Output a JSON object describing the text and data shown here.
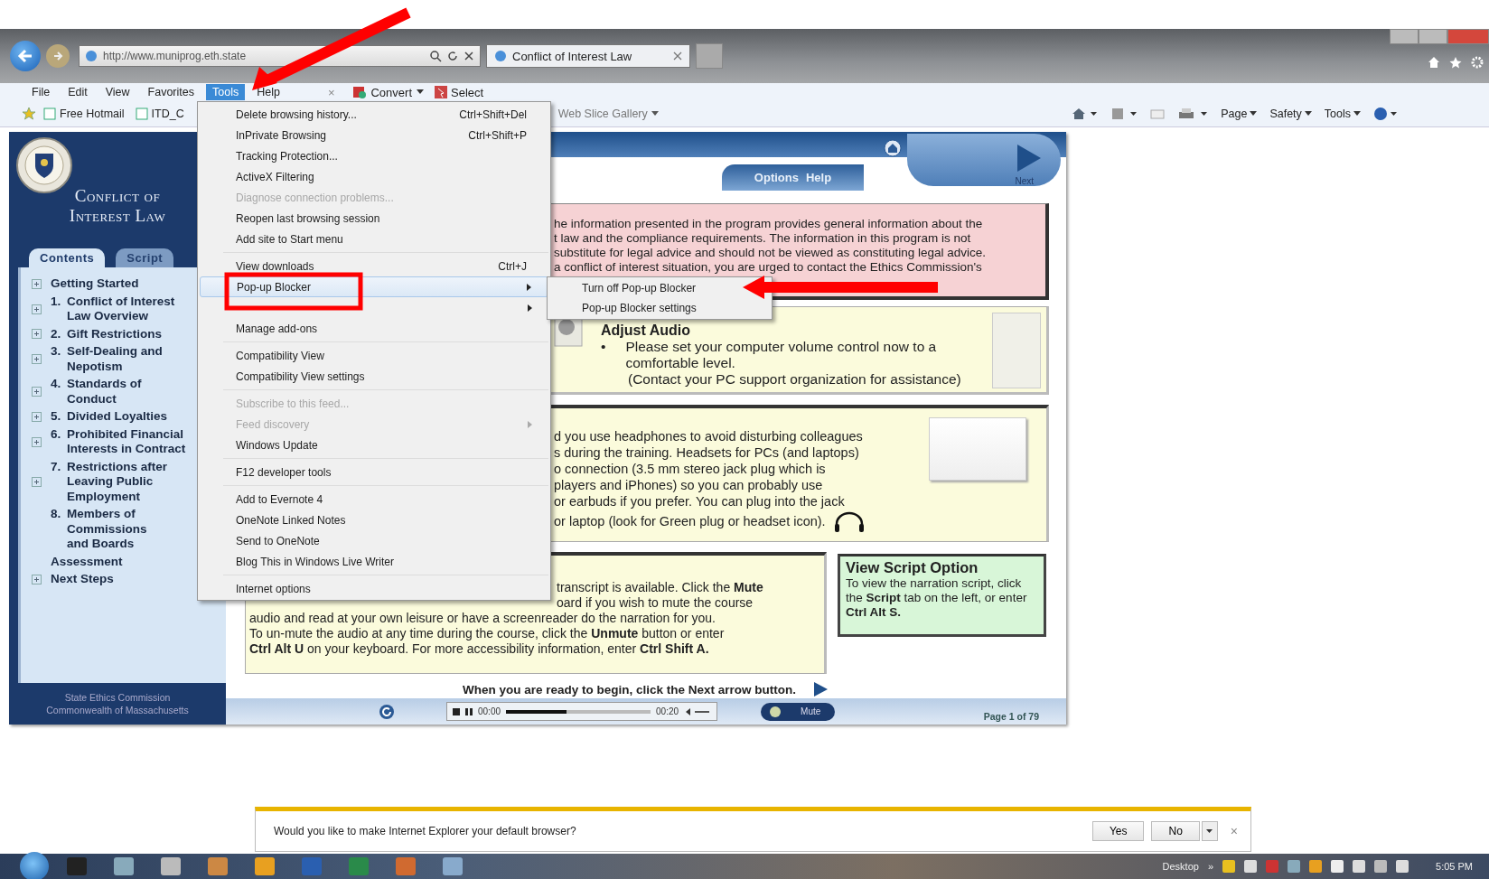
{
  "browser": {
    "address": "http://www.muniprog.eth.state",
    "tab_title": "Conflict of Interest Law",
    "menu_bar": [
      {
        "label": "File",
        "selected": false
      },
      {
        "label": "Edit",
        "selected": false
      },
      {
        "label": "View",
        "selected": false
      },
      {
        "label": "Favorites",
        "selected": false
      },
      {
        "label": "Tools",
        "selected": true
      },
      {
        "label": "Help",
        "selected": false
      }
    ],
    "close_glyph": "×",
    "convert": "Convert",
    "select": "Select",
    "favorites": [
      "Free Hotmail",
      "ITD_C"
    ],
    "web_slice": "Web Slice Gallery",
    "commands": [
      "Page",
      "Safety",
      "Tools"
    ]
  },
  "tools_menu": {
    "groups": [
      [
        {
          "label": "Delete browsing history...",
          "shortcut": "Ctrl+Shift+Del",
          "disabled": false,
          "submenu": false,
          "selected": false
        },
        {
          "label": "InPrivate Browsing",
          "shortcut": "Ctrl+Shift+P",
          "disabled": false,
          "submenu": false,
          "selected": false
        },
        {
          "label": "Tracking Protection...",
          "disabled": false,
          "submenu": false,
          "selected": false
        },
        {
          "label": "ActiveX Filtering",
          "disabled": false,
          "submenu": false,
          "selected": false
        },
        {
          "label": "Diagnose connection problems...",
          "disabled": true,
          "submenu": false,
          "selected": false
        },
        {
          "label": "Reopen last browsing session",
          "disabled": false,
          "submenu": false,
          "selected": false
        },
        {
          "label": "Add site to Start menu",
          "disabled": false,
          "submenu": false,
          "selected": false
        }
      ],
      [
        {
          "label": "View downloads",
          "shortcut": "Ctrl+J",
          "disabled": false,
          "submenu": false,
          "selected": false
        },
        {
          "label": "Pop-up Blocker",
          "disabled": false,
          "submenu": true,
          "selected": true
        },
        {
          "disabled": false,
          "submenu": true,
          "selected": false
        },
        {
          "label": "Manage add-ons",
          "disabled": false,
          "submenu": false,
          "selected": false
        }
      ],
      [
        {
          "label": "Compatibility View",
          "disabled": false,
          "submenu": false,
          "selected": false
        },
        {
          "label": "Compatibility View settings",
          "disabled": false,
          "submenu": false,
          "selected": false
        }
      ],
      [
        {
          "label": "Subscribe to this feed...",
          "disabled": true,
          "submenu": false,
          "selected": false
        },
        {
          "label": "Feed discovery",
          "disabled": true,
          "submenu": true,
          "selected": false
        },
        {
          "label": "Windows Update",
          "disabled": false,
          "submenu": false,
          "selected": false
        }
      ],
      [
        {
          "label": "F12 developer tools",
          "disabled": false,
          "submenu": false,
          "selected": false
        }
      ],
      [
        {
          "label": "Add to Evernote 4",
          "disabled": false,
          "submenu": false,
          "selected": false
        },
        {
          "label": "OneNote Linked Notes",
          "disabled": false,
          "submenu": false,
          "selected": false
        },
        {
          "label": "Send to OneNote",
          "disabled": false,
          "submenu": false,
          "selected": false
        },
        {
          "label": "Blog This in Windows Live Writer",
          "disabled": false,
          "submenu": false,
          "selected": false
        }
      ],
      [
        {
          "label": "Internet options",
          "disabled": false,
          "submenu": false,
          "selected": false
        }
      ]
    ]
  },
  "popup_submenu": [
    "Turn off Pop-up Blocker",
    "Pop-up Blocker settings"
  ],
  "course": {
    "sidebar": {
      "title": "Conflict of Interest Law",
      "tabs": [
        {
          "label": "Contents",
          "selected": true
        },
        {
          "label": "Script",
          "selected": false
        }
      ],
      "tree": [
        {
          "lines": [
            "Getting Started"
          ],
          "expandable": true
        },
        {
          "number": "1.",
          "lines": [
            "Conflict of Interest",
            "Law Overview"
          ],
          "expandable": true
        },
        {
          "number": "2.",
          "lines": [
            "Gift Restrictions"
          ],
          "expandable": true
        },
        {
          "number": "3.",
          "lines": [
            "Self-Dealing and",
            "Nepotism"
          ],
          "expandable": true
        },
        {
          "number": "4.",
          "lines": [
            "Standards of",
            "Conduct"
          ],
          "expandable": true
        },
        {
          "number": "5.",
          "lines": [
            "Divided Loyalties"
          ],
          "expandable": true
        },
        {
          "number": "6.",
          "lines": [
            "Prohibited Financial",
            "Interests in Contract"
          ],
          "expandable": true
        },
        {
          "number": "7.",
          "lines": [
            "Restrictions after",
            "Leaving Public",
            "Employment"
          ],
          "expandable": true
        },
        {
          "number": "8.",
          "lines": [
            "Members of",
            "Commissions",
            "and Boards"
          ],
          "expandable": false
        },
        {
          "lines": [
            "Assessment"
          ],
          "expandable": false
        },
        {
          "lines": [
            "Next Steps"
          ],
          "expandable": true
        }
      ],
      "footer": [
        "State Ethics Commission",
        "Commonwealth of Massachusetts"
      ]
    },
    "header": {
      "tabs": [
        "Options",
        "Help"
      ],
      "next_label": "Next"
    },
    "disclaimer": [
      "he information presented in the program provides general information about the",
      "t law and the compliance requirements. The information in this program is not",
      "substitute for legal advice and should not be viewed as constituting legal advice.",
      "a conflict of interest situation, you are urged to contact the Ethics Commission's"
    ],
    "audio": {
      "heading": "Adjust Audio",
      "bullet": "•",
      "text": "Please set your computer volume control now to a comfortable level.",
      "note": "(Contact your PC support organization for assistance)"
    },
    "headphones": [
      "d you use headphones to avoid disturbing colleagues",
      "s during the training. Headsets for PCs (and laptops)",
      "o connection  (3.5 mm stereo jack plug which is",
      "players and iPhones) so you can probably use",
      "or earbuds if you prefer.  You can plug into the jack",
      "or laptop (look for Green plug or headset icon)."
    ],
    "accessibility": {
      "covered_lines": [
        "transcript is available.  Click the **Mute**",
        "oard if you wish to mute the course"
      ],
      "lines": [
        "audio and read at your own leisure or have a screenreader do the narration for you.",
        "To un-mute the audio at any time during the course, click the **Unmute** button or enter",
        "**Ctrl Alt U** on your keyboard.  For more accessibility information, enter **Ctrl Shift A.**"
      ]
    },
    "script_option": {
      "title": "View Script Option",
      "text": "To view the narration script, click the **Script** tab on the left, or enter **Ctrl Alt S.**"
    },
    "prompt": "When you are ready to begin, click the Next arrow button.",
    "player": {
      "elapsed": "00:00",
      "progress": {
        "level": 0.42
      },
      "duration": "00:20",
      "mute": "Mute",
      "page": "Page 1 of 79"
    }
  },
  "notification": {
    "text": "Would you like to make Internet Explorer your default browser?",
    "yes": "Yes",
    "no": "No",
    "close": "×"
  },
  "taskbar": {
    "desktop": "Desktop",
    "overflow": "»",
    "time": "5:05 PM"
  }
}
